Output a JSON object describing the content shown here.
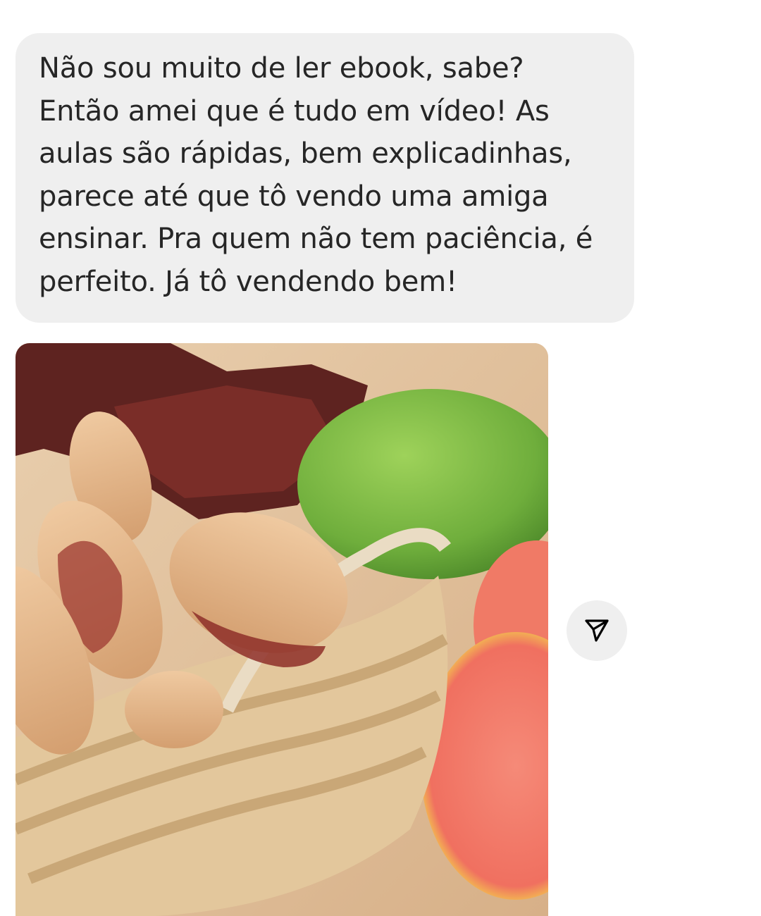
{
  "message": {
    "text": "Não sou muito de ler ebook, sabe?\nEntão amei que é tudo em vídeo! As\naulas são rápidas, bem explicadinhas,\nparece até que tô vendo uma amiga\nensinar. Pra quem não tem paciência, é\nperfeito. Já tô vendendo bem!"
  },
  "attachment": {
    "type": "image"
  },
  "share_button": {
    "icon": "send-icon"
  },
  "colors": {
    "bubble_background": "#efefef",
    "text": "#262626",
    "share_button_background": "#efefef"
  }
}
